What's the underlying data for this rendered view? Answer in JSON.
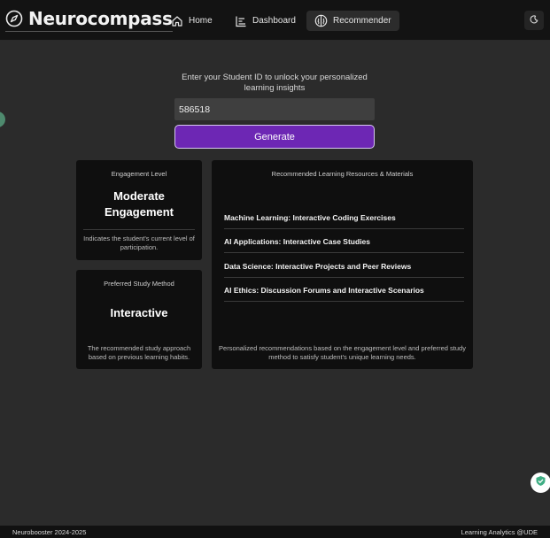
{
  "brand": {
    "name": "Neurocompass",
    "icon": "compass-icon"
  },
  "nav": {
    "tabs": [
      {
        "label": "Home",
        "icon": "home-icon",
        "active": false
      },
      {
        "label": "Dashboard",
        "icon": "bar-chart-icon",
        "active": false
      },
      {
        "label": "Recommender",
        "icon": "brain-icon",
        "active": true
      }
    ],
    "theme_toggle_icon": "moon-icon"
  },
  "student_id": {
    "prompt": "Enter your Student ID to unlock your personalized learning insights",
    "value": "586518",
    "button_label": "Generate"
  },
  "engagement": {
    "title": "Engagement Level",
    "value_line1": "Moderate",
    "value_line2": "Engagement",
    "description": "Indicates the student's current level of participation."
  },
  "study_method": {
    "title": "Preferred Study Method",
    "value": "Interactive",
    "description": "The recommended study approach based on previous learning habits."
  },
  "resources": {
    "title": "Recommended Learning Resources & Materials",
    "items": [
      "Machine Learning: Interactive Coding Exercises",
      "AI Applications: Interactive Case Studies",
      "Data Science: Interactive Projects and Peer Reviews",
      "AI Ethics: Discussion Forums and Interactive Scenarios"
    ],
    "description": "Personalized recommendations based on the engagement level and preferred study method to satisfy student's unique learning needs."
  },
  "footer": {
    "left": "Neurobooster 2024-2025",
    "right": "Learning Analytics @UDE"
  },
  "colors": {
    "accent": "#6d27b4",
    "background": "#2b2b2b",
    "card": "#0f0f0f",
    "shield": "#3fae84"
  }
}
